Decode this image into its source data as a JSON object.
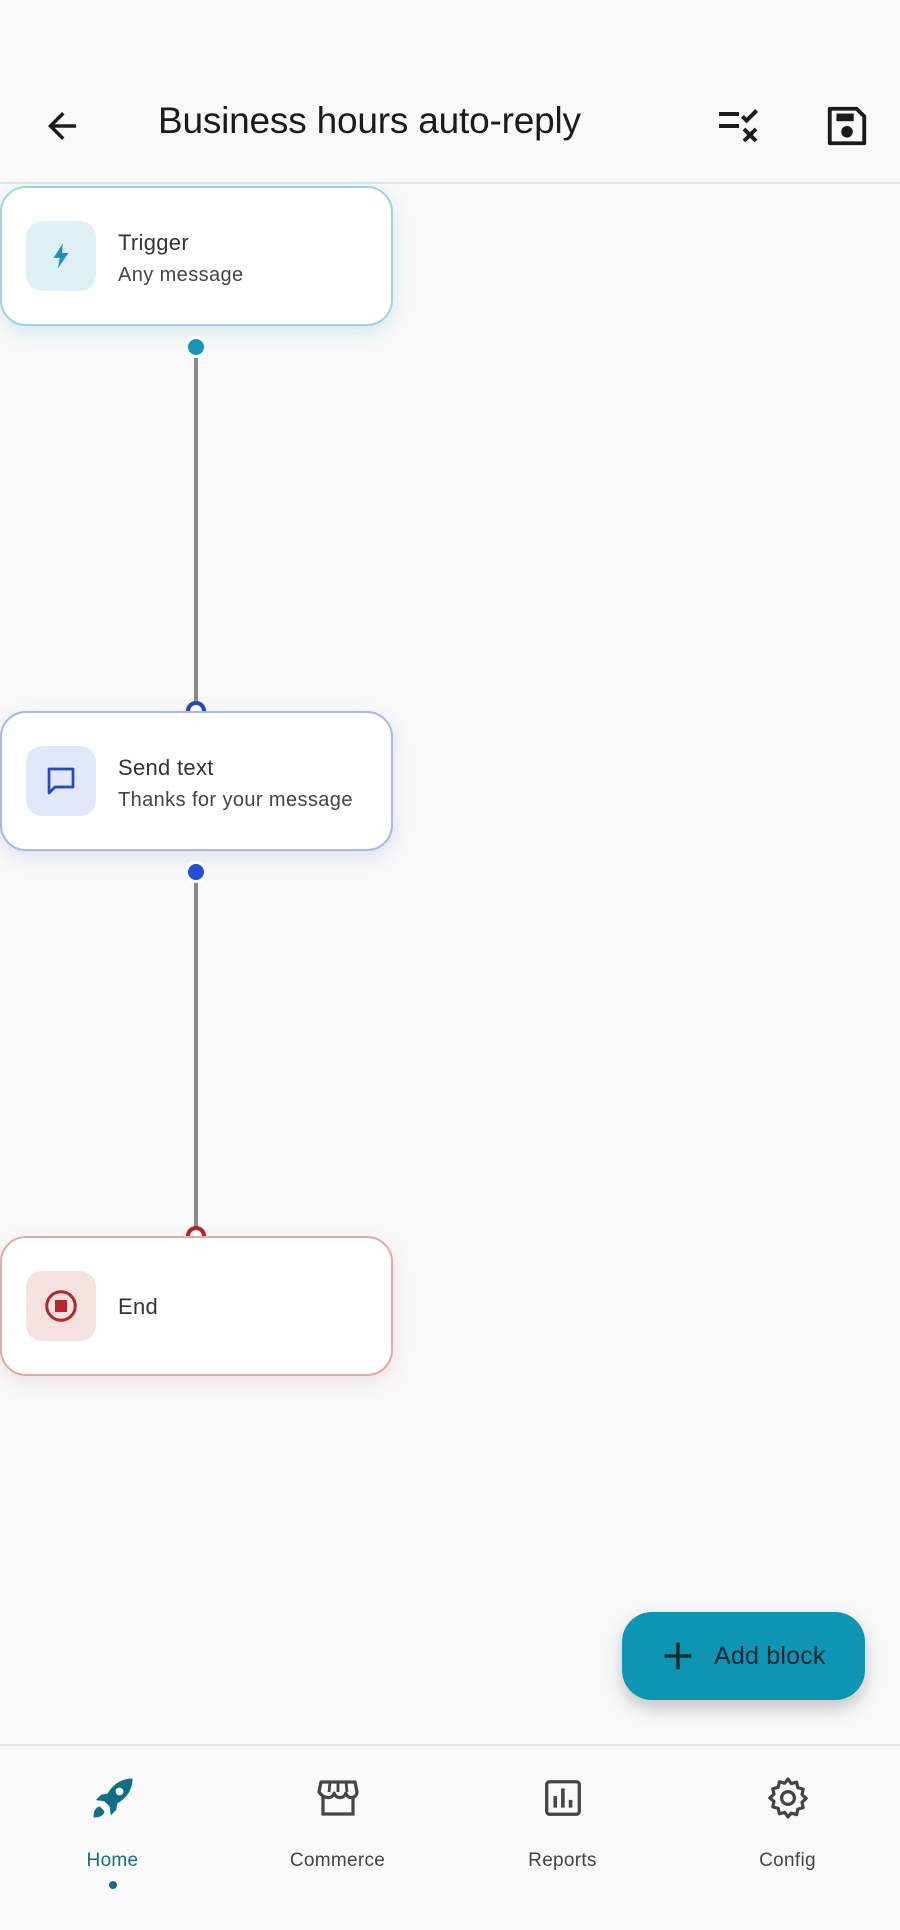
{
  "header": {
    "title": "Business hours auto-reply",
    "back_icon": "arrow-left-icon",
    "checklist_icon": "checklist-icon",
    "save_icon": "save-icon"
  },
  "nodes": [
    {
      "type": "trigger",
      "title": "Trigger",
      "subtitle": "Any message",
      "icon": "bolt-icon",
      "color": "#1596b4"
    },
    {
      "type": "send",
      "title": "Send text",
      "subtitle": "Thanks for your message",
      "icon": "chat-icon",
      "color": "#2447c4"
    },
    {
      "type": "end",
      "title": "End",
      "subtitle": "",
      "icon": "stop-icon",
      "color": "#b3262b"
    }
  ],
  "fab": {
    "label": "Add block",
    "icon": "plus-icon"
  },
  "nav": {
    "items": [
      {
        "label": "Home",
        "icon": "rocket-icon",
        "active": true
      },
      {
        "label": "Commerce",
        "icon": "store-icon",
        "active": false
      },
      {
        "label": "Reports",
        "icon": "bar-chart-icon",
        "active": false
      },
      {
        "label": "Config",
        "icon": "gear-icon",
        "active": false
      }
    ]
  },
  "colors": {
    "accent": "#0c96b3",
    "nav_active": "#0d6e88",
    "background": "#f9f9f9"
  }
}
